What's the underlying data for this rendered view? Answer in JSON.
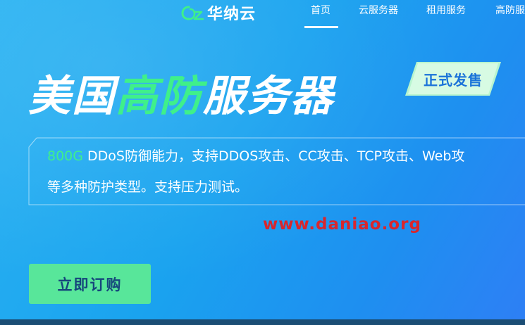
{
  "header": {
    "logo_text": "华纳云",
    "nav": [
      {
        "label": "首页",
        "active": true
      },
      {
        "label": "云服务器"
      },
      {
        "label": "租用服务"
      },
      {
        "label": "高防服"
      }
    ]
  },
  "hero": {
    "title_part1": "美国",
    "title_part2": "高防",
    "title_part3": "服务器",
    "badge": "正式发售",
    "desc_highlight": "800G",
    "desc_line1_rest": " DDoS防御能力，支持DDOS攻击、CC攻击、TCP攻击、Web攻",
    "desc_line2": "等多种防护类型。支持压力测试。",
    "watermark": "www.daniao.org",
    "buy_button": "立即订购"
  },
  "colors": {
    "accent_green": "#3ff08a",
    "button_green": "#58e69a",
    "watermark_red": "#d9262c",
    "background_blue": "#1aa3ef"
  },
  "icons": {
    "logo": "cloud-logo-icon"
  }
}
